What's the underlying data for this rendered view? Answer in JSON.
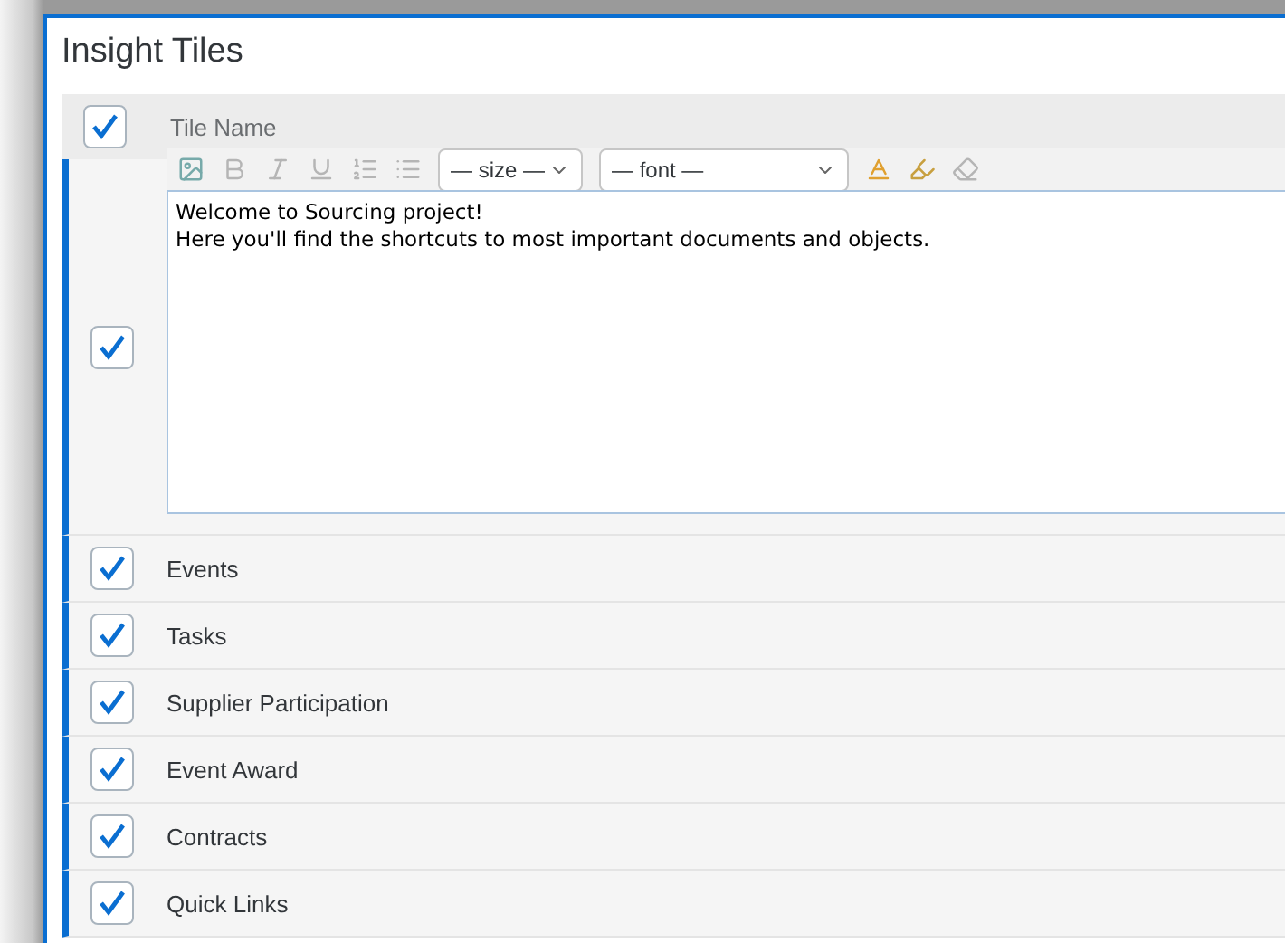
{
  "title": "Insight Tiles",
  "header": {
    "checked": true,
    "label": "Tile Name"
  },
  "editor": {
    "size_select": "— size —",
    "font_select": "— font —"
  },
  "rows": [
    {
      "kind": "editor",
      "checked": true,
      "lines": [
        "Welcome to Sourcing project!",
        "Here you'll find the shortcuts to most important documents and objects."
      ]
    },
    {
      "kind": "tile",
      "checked": true,
      "name": "Events"
    },
    {
      "kind": "tile",
      "checked": true,
      "name": "Tasks"
    },
    {
      "kind": "tile",
      "checked": true,
      "name": "Supplier Participation"
    },
    {
      "kind": "tile",
      "checked": true,
      "name": "Event Award"
    },
    {
      "kind": "tile",
      "checked": true,
      "name": "Contracts"
    },
    {
      "kind": "tile",
      "checked": true,
      "name": "Quick Links"
    }
  ]
}
